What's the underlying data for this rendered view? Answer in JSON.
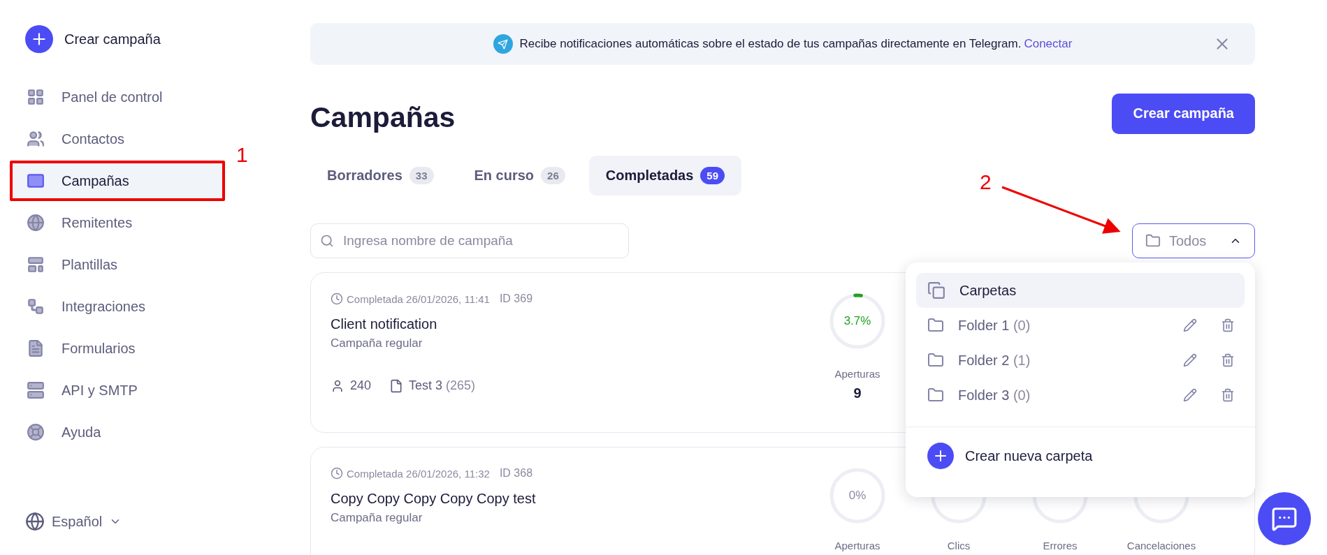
{
  "sidebar": {
    "create_button": "Crear campaña",
    "items": [
      {
        "label": "Panel de control",
        "selected": false
      },
      {
        "label": "Contactos",
        "selected": false
      },
      {
        "label": "Campañas",
        "selected": true
      },
      {
        "label": "Remitentes",
        "selected": false
      },
      {
        "label": "Plantillas",
        "selected": false
      },
      {
        "label": "Integraciones",
        "selected": false
      },
      {
        "label": "Formularios",
        "selected": false
      },
      {
        "label": "API y SMTP",
        "selected": false
      },
      {
        "label": "Ayuda",
        "selected": false
      }
    ],
    "language": "Español"
  },
  "banner": {
    "text": "Recibe notificaciones automáticas sobre el estado de tus campañas directamente en Telegram.",
    "link": "Conectar"
  },
  "page_title": "Campañas",
  "create_button": "Crear campaña",
  "tabs": [
    {
      "label": "Borradores",
      "count": "33",
      "selected": false
    },
    {
      "label": "En curso",
      "count": "26",
      "selected": false
    },
    {
      "label": "Completadas",
      "count": "59",
      "selected": true
    }
  ],
  "search": {
    "placeholder": "Ingresa nombre de campaña"
  },
  "folder_filter": {
    "label": "Todos",
    "expanded": true
  },
  "folder_menu": {
    "header": "Carpetas",
    "folders": [
      {
        "name": "Folder 1",
        "count": "(0)"
      },
      {
        "name": "Folder 2",
        "count": "(1)"
      },
      {
        "name": "Folder 3",
        "count": "(0)"
      }
    ],
    "create": "Crear nueva carpeta"
  },
  "campaigns": [
    {
      "status": "Completada 26/01/2026, 11:41",
      "id": "ID 369",
      "name": "Client notification",
      "type": "Campaña regular",
      "recipients": "240",
      "list": "Test 3",
      "list_count": "(265)",
      "stats": [
        {
          "label": "Aperturas",
          "percent": "3.7%",
          "value": "9"
        }
      ]
    },
    {
      "status": "Completada 26/01/2026, 11:32",
      "id": "ID 368",
      "name": "Copy Copy Copy Copy Copy test",
      "type": "Campaña regular",
      "stats": [
        {
          "label": "Aperturas",
          "percent": "0%"
        },
        {
          "label": "Clics"
        },
        {
          "label": "Errores"
        },
        {
          "label": "Cancelaciones"
        }
      ]
    }
  ],
  "annotations": [
    {
      "label": "1"
    },
    {
      "label": "2"
    }
  ]
}
